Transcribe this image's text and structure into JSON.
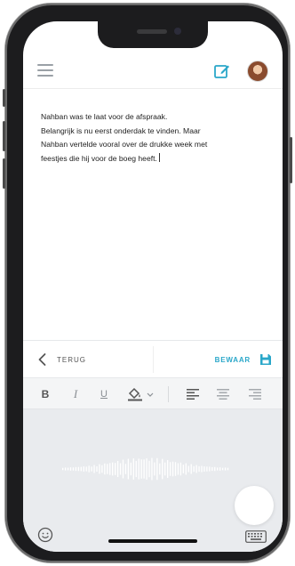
{
  "header": {
    "menu_icon": "hamburger-icon",
    "compose_icon": "edit-note-icon",
    "avatar_icon": "user-avatar"
  },
  "note": {
    "lines": [
      "Nahban was te laat voor de afspraak.",
      "Belangrijk is nu eerst onderdak te vinden. Maar",
      "Nahban vertelde vooral over de drukke week met",
      "feestjes die hij voor de boeg heeft."
    ]
  },
  "actions": {
    "back_label": "TERUG",
    "save_label": "BEWAAR"
  },
  "format": {
    "bold": "B",
    "italic": "I",
    "underline": "U"
  },
  "colors": {
    "accent": "#2aa7c9",
    "icon_gray": "#9aa0a6",
    "voice_bg": "#e9ebee"
  }
}
